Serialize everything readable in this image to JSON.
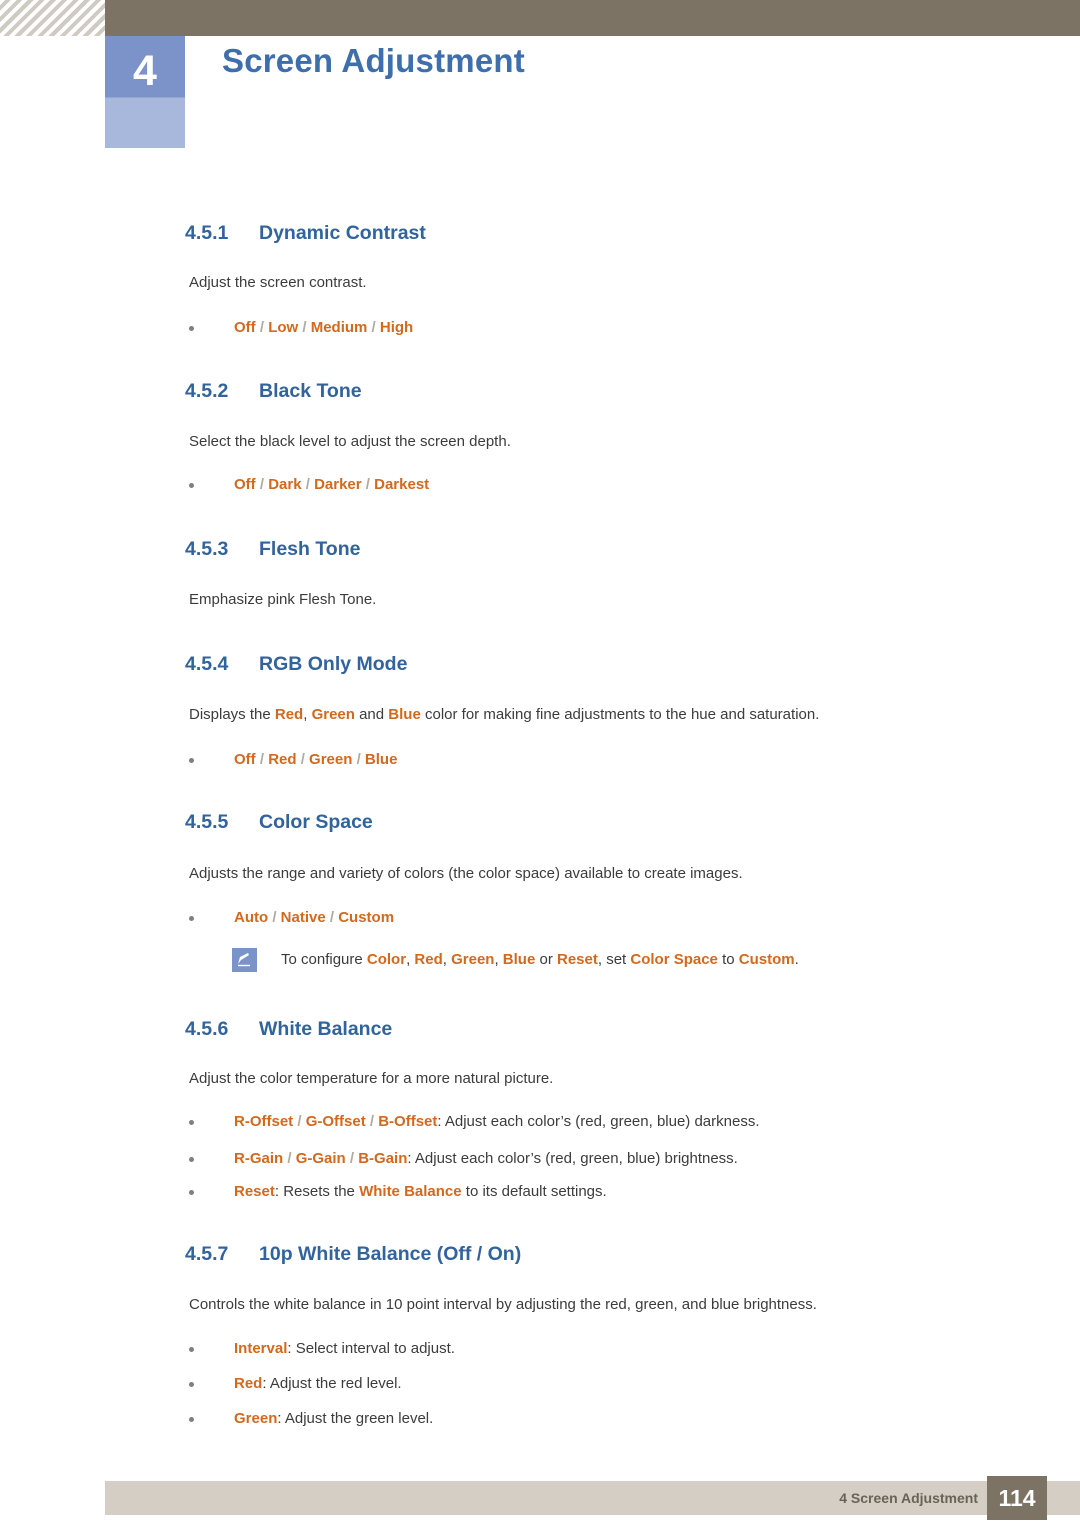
{
  "header": {
    "chapter_number": "4",
    "chapter_title": "Screen Adjustment",
    "bar_color": "#7d7365",
    "accent_color": "#7a93c9",
    "title_color": "#3f6ead"
  },
  "sections": [
    {
      "number": "4.5.1",
      "title": "Dynamic Contrast",
      "paragraph": "Adjust the screen contrast.",
      "bullets": [
        {
          "parts": [
            {
              "t": "Off",
              "s": "orange"
            },
            {
              "t": " / ",
              "s": "sep"
            },
            {
              "t": "Low",
              "s": "orange"
            },
            {
              "t": " / ",
              "s": "sep"
            },
            {
              "t": "Medium",
              "s": "orange"
            },
            {
              "t": " / ",
              "s": "sep"
            },
            {
              "t": "High",
              "s": "orange"
            }
          ]
        }
      ]
    },
    {
      "number": "4.5.2",
      "title": "Black Tone",
      "paragraph": "Select the black level to adjust the screen depth.",
      "bullets": [
        {
          "parts": [
            {
              "t": "Off",
              "s": "orange"
            },
            {
              "t": " / ",
              "s": "sep"
            },
            {
              "t": "Dark",
              "s": "orange"
            },
            {
              "t": " / ",
              "s": "sep"
            },
            {
              "t": "Darker",
              "s": "orange"
            },
            {
              "t": " / ",
              "s": "sep"
            },
            {
              "t": "Darkest",
              "s": "orange"
            }
          ]
        }
      ]
    },
    {
      "number": "4.5.3",
      "title": "Flesh Tone",
      "paragraph": "Emphasize pink Flesh Tone.",
      "bullets": []
    },
    {
      "number": "4.5.4",
      "title": "RGB Only Mode",
      "paragraph_parts": [
        {
          "t": "Displays the ",
          "s": "plain"
        },
        {
          "t": "Red",
          "s": "orange"
        },
        {
          "t": ", ",
          "s": "plain"
        },
        {
          "t": "Green",
          "s": "orange"
        },
        {
          "t": " and ",
          "s": "plain"
        },
        {
          "t": "Blue",
          "s": "orange"
        },
        {
          "t": " color for making fine adjustments to the hue and saturation.",
          "s": "plain"
        }
      ],
      "bullets": [
        {
          "parts": [
            {
              "t": "Off",
              "s": "orange"
            },
            {
              "t": " / ",
              "s": "sep"
            },
            {
              "t": "Red",
              "s": "orange"
            },
            {
              "t": " / ",
              "s": "sep"
            },
            {
              "t": "Green",
              "s": "orange"
            },
            {
              "t": " / ",
              "s": "sep"
            },
            {
              "t": "Blue",
              "s": "orange"
            }
          ]
        }
      ]
    },
    {
      "number": "4.5.5",
      "title": "Color Space",
      "paragraph": "Adjusts the range and variety of colors (the color space) available to create images.",
      "bullets": [
        {
          "parts": [
            {
              "t": "Auto",
              "s": "orange"
            },
            {
              "t": " / ",
              "s": "sep"
            },
            {
              "t": "Native",
              "s": "orange"
            },
            {
              "t": " / ",
              "s": "sep"
            },
            {
              "t": "Custom",
              "s": "orange"
            }
          ]
        }
      ],
      "note": {
        "icon": "note-pencil-icon",
        "parts": [
          {
            "t": "To configure ",
            "s": "plain"
          },
          {
            "t": "Color",
            "s": "orange"
          },
          {
            "t": ", ",
            "s": "plain"
          },
          {
            "t": "Red",
            "s": "orange"
          },
          {
            "t": ", ",
            "s": "plain"
          },
          {
            "t": "Green",
            "s": "orange"
          },
          {
            "t": ", ",
            "s": "plain"
          },
          {
            "t": "Blue",
            "s": "orange"
          },
          {
            "t": " or ",
            "s": "plain"
          },
          {
            "t": "Reset",
            "s": "orange"
          },
          {
            "t": ", set ",
            "s": "plain"
          },
          {
            "t": "Color Space",
            "s": "orange"
          },
          {
            "t": " to ",
            "s": "plain"
          },
          {
            "t": "Custom",
            "s": "orange"
          },
          {
            "t": ".",
            "s": "plain"
          }
        ]
      }
    },
    {
      "number": "4.5.6",
      "title": "White Balance",
      "paragraph": "Adjust the color temperature for a more natural picture.",
      "bullets": [
        {
          "parts": [
            {
              "t": "R-Offset",
              "s": "orange"
            },
            {
              "t": " / ",
              "s": "sep"
            },
            {
              "t": "G-Offset",
              "s": "orange"
            },
            {
              "t": " / ",
              "s": "sep"
            },
            {
              "t": "B-Offset",
              "s": "orange"
            },
            {
              "t": ": Adjust each color’s (red, green, blue) darkness.",
              "s": "plain"
            }
          ]
        },
        {
          "parts": [
            {
              "t": "R-Gain",
              "s": "orange"
            },
            {
              "t": " / ",
              "s": "sep"
            },
            {
              "t": "G-Gain",
              "s": "orange"
            },
            {
              "t": " / ",
              "s": "sep"
            },
            {
              "t": "B-Gain",
              "s": "orange"
            },
            {
              "t": ": Adjust each color’s (red, green, blue) brightness.",
              "s": "plain"
            }
          ]
        },
        {
          "parts": [
            {
              "t": "Reset",
              "s": "orange"
            },
            {
              "t": ": Resets the ",
              "s": "plain"
            },
            {
              "t": "White Balance",
              "s": "orange"
            },
            {
              "t": " to its default settings.",
              "s": "plain"
            }
          ]
        }
      ]
    },
    {
      "number": "4.5.7",
      "title": "10p White Balance (Off / On)",
      "paragraph": "Controls the white balance in 10 point interval by adjusting the red, green, and blue brightness.",
      "bullets": [
        {
          "parts": [
            {
              "t": "Interval",
              "s": "orange"
            },
            {
              "t": ": Select interval to adjust.",
              "s": "plain"
            }
          ]
        },
        {
          "parts": [
            {
              "t": "Red",
              "s": "orange"
            },
            {
              "t": ": Adjust the red level.",
              "s": "plain"
            }
          ]
        },
        {
          "parts": [
            {
              "t": "Green",
              "s": "orange"
            },
            {
              "t": ": Adjust the green level.",
              "s": "plain"
            }
          ]
        }
      ]
    }
  ],
  "footer": {
    "label": "4 Screen Adjustment",
    "page_number": "114",
    "bar_color": "#d4cec4",
    "page_box_color": "#7d7365"
  }
}
